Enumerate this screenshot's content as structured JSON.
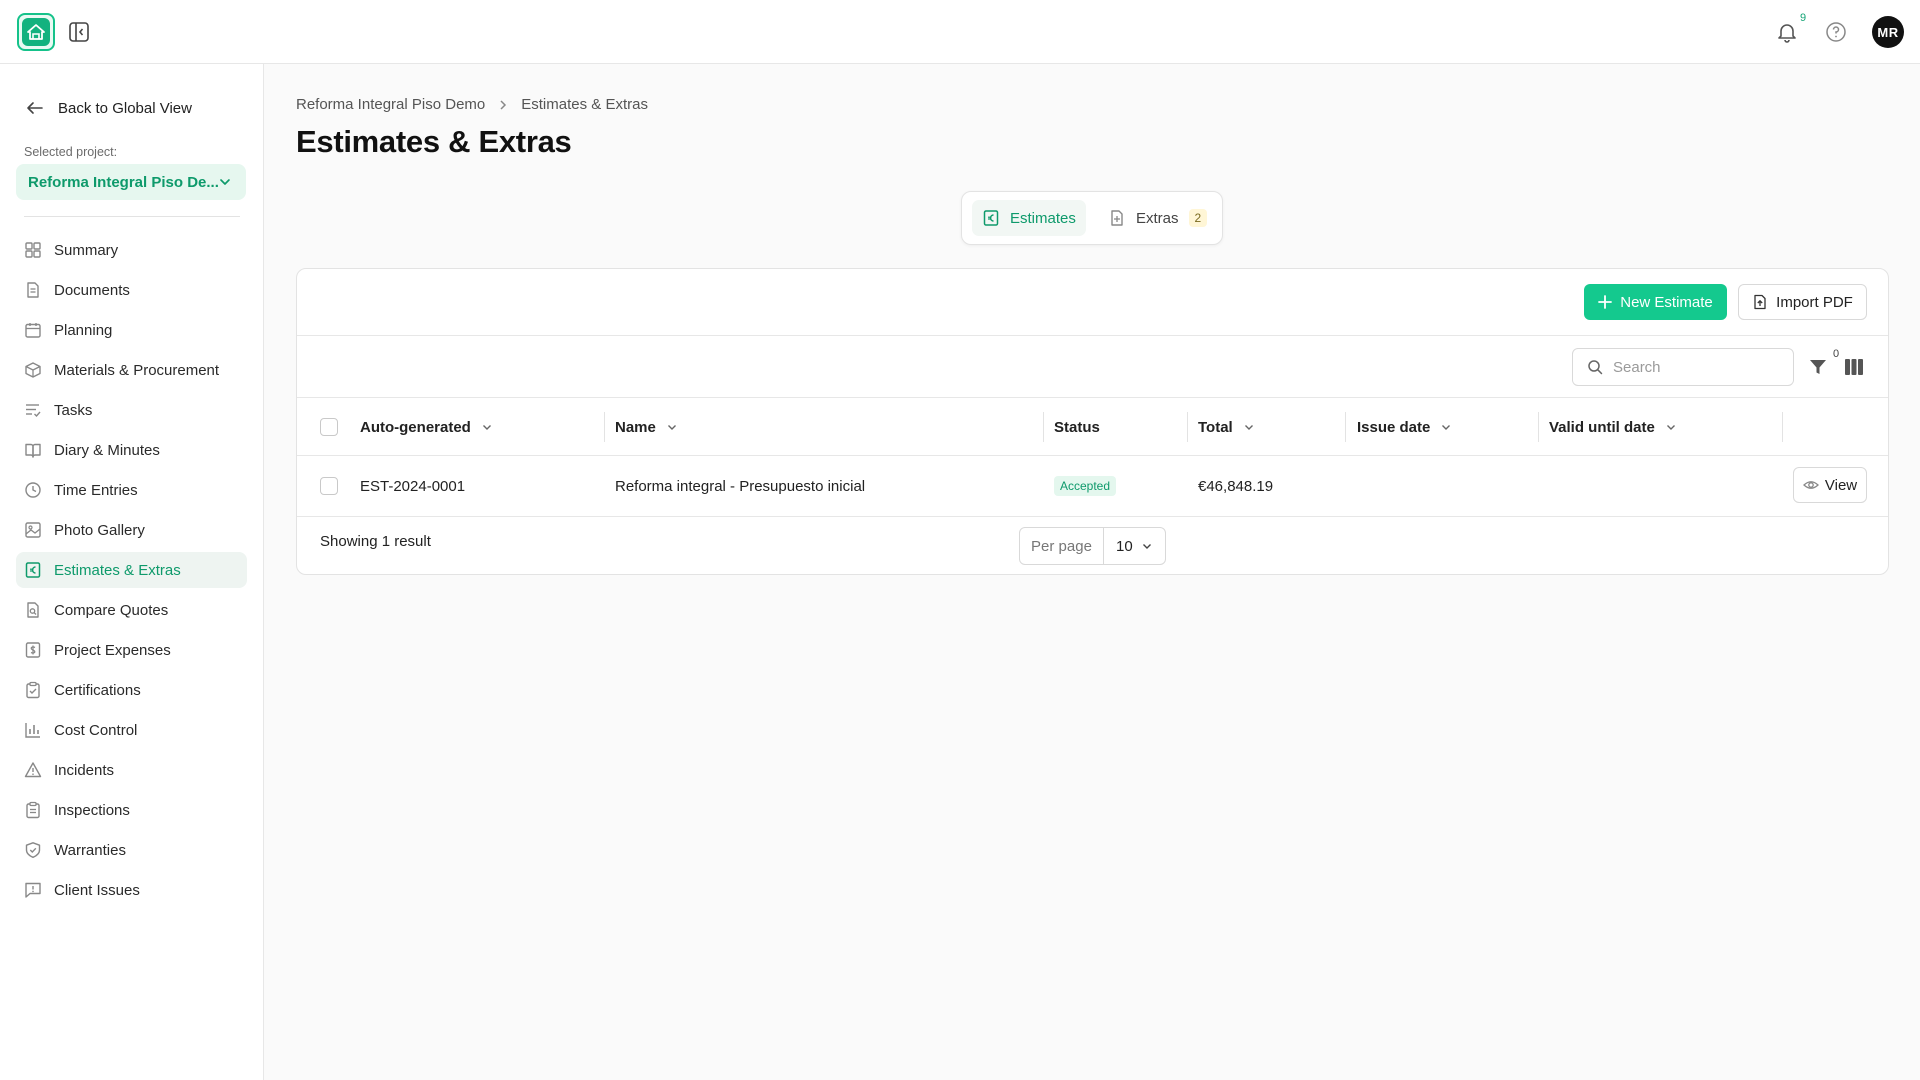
{
  "topbar": {
    "notifications_count": "9",
    "avatar_initials": "MR"
  },
  "sidebar": {
    "back_label": "Back to Global View",
    "selected_project_label": "Selected project:",
    "selected_project_value": "Reforma Integral Piso De...",
    "items": [
      {
        "label": "Summary",
        "icon": "grid-icon"
      },
      {
        "label": "Documents",
        "icon": "document-icon"
      },
      {
        "label": "Planning",
        "icon": "calendar-icon"
      },
      {
        "label": "Materials & Procurement",
        "icon": "box-icon"
      },
      {
        "label": "Tasks",
        "icon": "checklist-icon"
      },
      {
        "label": "Diary & Minutes",
        "icon": "book-icon"
      },
      {
        "label": "Time Entries",
        "icon": "clock-icon"
      },
      {
        "label": "Photo Gallery",
        "icon": "image-icon"
      },
      {
        "label": "Estimates & Extras",
        "icon": "euro-doc-icon",
        "active": true
      },
      {
        "label": "Compare Quotes",
        "icon": "search-doc-icon"
      },
      {
        "label": "Project Expenses",
        "icon": "dollar-doc-icon"
      },
      {
        "label": "Certifications",
        "icon": "clipboard-check-icon"
      },
      {
        "label": "Cost Control",
        "icon": "bar-chart-icon"
      },
      {
        "label": "Incidents",
        "icon": "warning-icon"
      },
      {
        "label": "Inspections",
        "icon": "clipboard-list-icon"
      },
      {
        "label": "Warranties",
        "icon": "shield-check-icon"
      },
      {
        "label": "Client Issues",
        "icon": "message-alert-icon"
      }
    ]
  },
  "breadcrumb": {
    "project": "Reforma Integral Piso Demo",
    "current": "Estimates & Extras"
  },
  "page": {
    "title": "Estimates & Extras"
  },
  "tabs": [
    {
      "label": "Estimates",
      "active": true
    },
    {
      "label": "Extras",
      "badge": "2"
    }
  ],
  "actions": {
    "new_estimate": "New Estimate",
    "import_pdf": "Import PDF"
  },
  "toolbar": {
    "search_placeholder": "Search",
    "filter_count": "0"
  },
  "table": {
    "columns": [
      "Auto-generated",
      "Name",
      "Status",
      "Total",
      "Issue date",
      "Valid until date"
    ],
    "rows": [
      {
        "code": "EST-2024-0001",
        "name": "Reforma integral - Presupuesto inicial",
        "status": "Accepted",
        "total": "€46,848.19",
        "issue_date": "",
        "valid_until": "",
        "action": "View"
      }
    ]
  },
  "footer": {
    "showing": "Showing 1 result",
    "per_page_label": "Per page",
    "per_page_value": "10"
  },
  "colors": {
    "accent": "#14c98e",
    "accent_text": "#0e9a6b",
    "active_bg": "#eef4f1"
  }
}
